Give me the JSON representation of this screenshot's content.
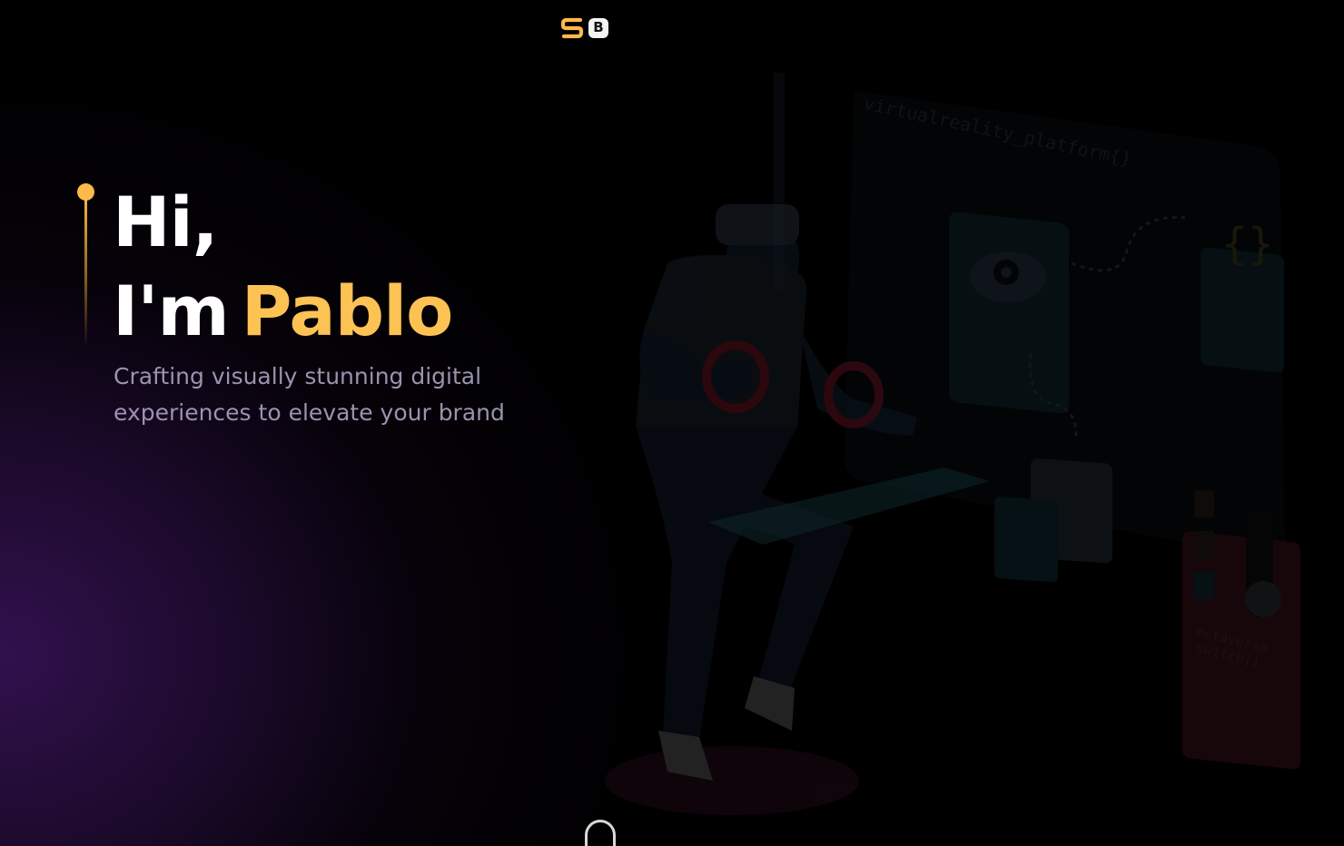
{
  "logo": {
    "letter_s": "S",
    "letter_b": "B",
    "accent_color": "#fdb94a"
  },
  "hero": {
    "greeting": "Hi,",
    "intro": "I'm",
    "name": "Pablo",
    "subtitle": "Crafting visually stunning digital experiences to elevate your brand",
    "accent_color": "#fdc254"
  },
  "illustration": {
    "code_label_top": "virtualreality_platform{}",
    "braces_label": "{}",
    "code_label_bottom_1": "metaverse",
    "code_label_bottom_2": "switch()"
  },
  "scroll": {
    "icon": "mouse-scroll-icon"
  }
}
